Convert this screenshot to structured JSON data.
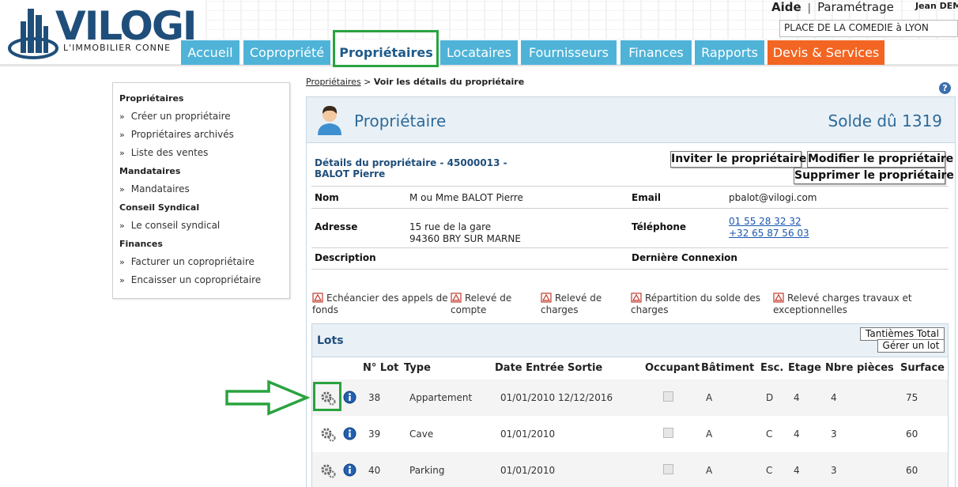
{
  "header": {
    "logo_text": "VILOGI",
    "logo_tagline": "L'IMMOBILIER CONNE",
    "help_link": "Aide",
    "settings_link": "Paramétrage",
    "user_name": "Jean DEM",
    "residence_value": "PLACE DE LA COMEDIE à LYON"
  },
  "nav": {
    "tabs": [
      {
        "label": "Accueil"
      },
      {
        "label": "Copropriété"
      },
      {
        "label": "Propriétaires"
      },
      {
        "label": "Locataires"
      },
      {
        "label": "Fournisseurs"
      },
      {
        "label": "Finances"
      },
      {
        "label": "Rapports"
      },
      {
        "label": "Devis & Services"
      }
    ],
    "active_tab": "Propriétaires"
  },
  "sidebar": {
    "sections": [
      {
        "title": "Propriétaires",
        "items": [
          "Créer un propriétaire",
          "Propriétaires archivés",
          "Liste des ventes"
        ]
      },
      {
        "title": "Mandataires",
        "items": [
          "Mandataires"
        ]
      },
      {
        "title": "Conseil Syndical",
        "items": [
          "Le conseil syndical"
        ]
      },
      {
        "title": "Finances",
        "items": [
          "Facturer un copropriétaire",
          "Encaisser un copropriétaire"
        ]
      }
    ]
  },
  "breadcrumb": {
    "link": "Propriétaires",
    "separator": " > ",
    "current": "Voir les détails du propriétaire"
  },
  "panel": {
    "title": "Propriétaire",
    "solde": "Solde dû 1319",
    "details_title": "Détails du propriétaire - 45000013 - BALOT Pierre",
    "buttons": {
      "invite": "Inviter le propriétaire",
      "edit": "Modifier le propriétaire",
      "delete": "Supprimer le propriétaire"
    },
    "fields": {
      "nom_label": "Nom",
      "nom_value": "M ou Mme BALOT Pierre",
      "email_label": "Email",
      "email_value": "pbalot@vilogi.com",
      "adresse_label": "Adresse",
      "adresse_line1": "15 rue de la gare",
      "adresse_line2": "94360 BRY SUR MARNE",
      "telephone_label": "Téléphone",
      "telephone_1": "01 55 28 32 32",
      "telephone_2": "+32 65 87 56 03",
      "description_label": "Description",
      "derniere_connexion_label": "Dernière Connexion"
    },
    "documents": [
      "Echéancier des appels de fonds",
      "Relevé de compte",
      "Relevé de charges",
      "Répartition du solde des charges",
      "Relevé charges travaux et exceptionnelles"
    ]
  },
  "lots": {
    "title": "Lots",
    "btn_tantiemes": "Tantièmes Total",
    "btn_gerer": "Gérer un lot",
    "columns": [
      "N° Lot",
      "Type",
      "Date Entrée Sortie",
      "Occupant",
      "Bâtiment",
      "Esc.",
      "Etage",
      "Nbre pièces",
      "Surface"
    ],
    "rows": [
      {
        "num": "38",
        "type": "Appartement",
        "dates": "01/01/2010 12/12/2016",
        "occupant": false,
        "batiment": "A",
        "esc": "D",
        "etage": "4",
        "pieces": "4",
        "surface": "75"
      },
      {
        "num": "39",
        "type": "Cave",
        "dates": "01/01/2010",
        "occupant": false,
        "batiment": "A",
        "esc": "C",
        "etage": "4",
        "pieces": "3",
        "surface": "60"
      },
      {
        "num": "40",
        "type": "Parking",
        "dates": "01/01/2010",
        "occupant": false,
        "batiment": "A",
        "esc": "C",
        "etage": "4",
        "pieces": "3",
        "surface": "60"
      }
    ]
  },
  "colors": {
    "nav_blue": "#4fb3d8",
    "nav_orange": "#f26522",
    "brand_dark": "#1f4e7a",
    "highlight_green": "#2aa33f"
  }
}
